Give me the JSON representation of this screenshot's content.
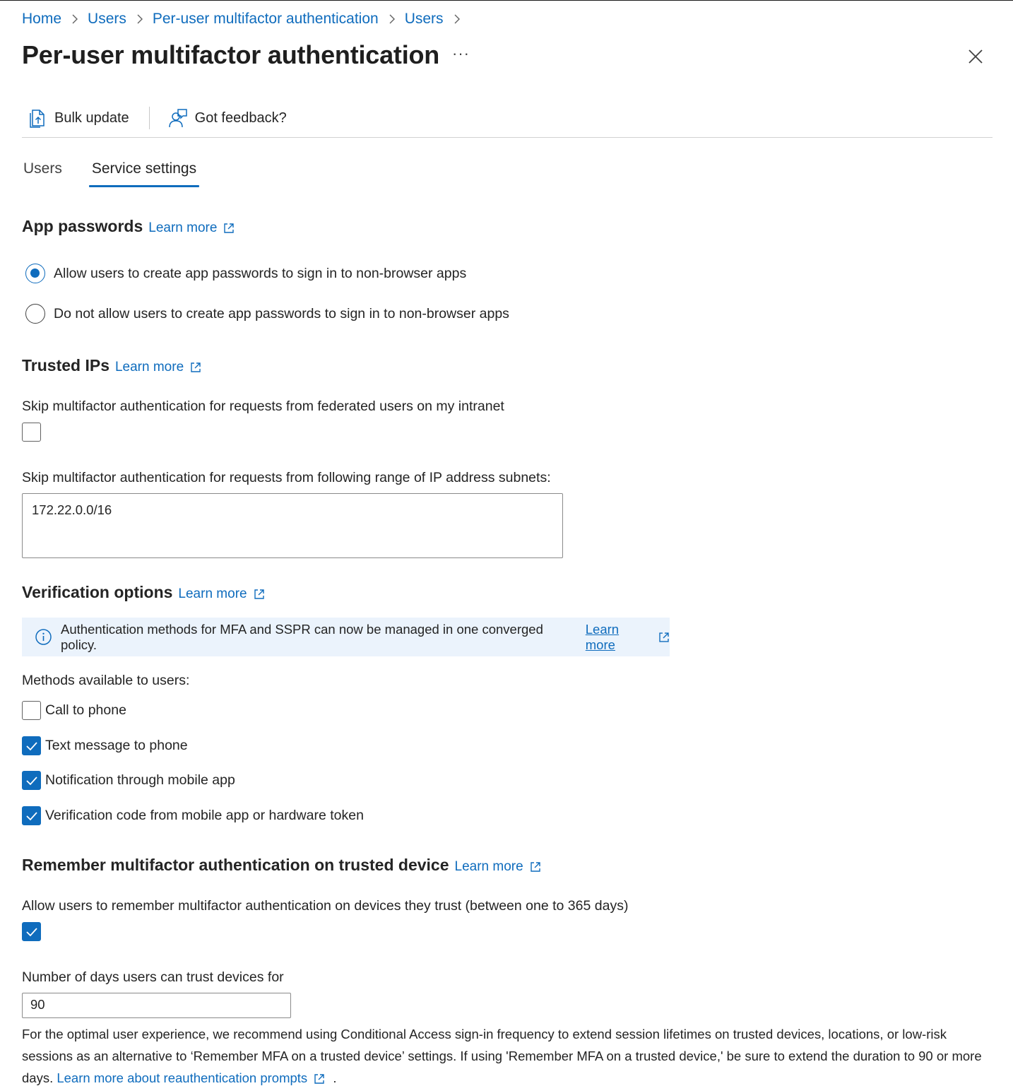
{
  "breadcrumb": [
    "Home",
    "Users",
    "Per-user multifactor authentication",
    "Users"
  ],
  "header": {
    "title": "Per-user multifactor authentication",
    "more": "···"
  },
  "toolbar": {
    "bulk_update": "Bulk update",
    "feedback": "Got feedback?"
  },
  "tabs": [
    {
      "label": "Users",
      "active": false
    },
    {
      "label": "Service settings",
      "active": true
    }
  ],
  "app_passwords": {
    "heading": "App passwords",
    "learn_more": "Learn more",
    "options": [
      {
        "label": "Allow users to create app passwords to sign in to non-browser apps",
        "selected": true
      },
      {
        "label": "Do not allow users to create app passwords to sign in to non-browser apps",
        "selected": false
      }
    ]
  },
  "trusted_ips": {
    "heading": "Trusted IPs",
    "learn_more": "Learn more",
    "skip_federated_label": "Skip multifactor authentication for requests from federated users on my intranet",
    "skip_federated_checked": false,
    "subnets_label": "Skip multifactor authentication for requests from following range of IP address subnets:",
    "subnets_value": "172.22.0.0/16"
  },
  "verification": {
    "heading": "Verification options",
    "learn_more": "Learn more",
    "info_text": "Authentication methods for MFA and SSPR can now be managed in one converged policy.",
    "info_link": "Learn more",
    "methods_label": "Methods available to users:",
    "methods": [
      {
        "label": "Call to phone",
        "checked": false
      },
      {
        "label": "Text message to phone",
        "checked": true
      },
      {
        "label": "Notification through mobile app",
        "checked": true
      },
      {
        "label": "Verification code from mobile app or hardware token",
        "checked": true
      }
    ]
  },
  "remember": {
    "heading": "Remember multifactor authentication on trusted device",
    "learn_more": "Learn more",
    "allow_label": "Allow users to remember multifactor authentication on devices they trust (between one to 365 days)",
    "allow_checked": true,
    "days_label": "Number of days users can trust devices for",
    "days_value": "90",
    "note_text": "For the optimal user experience, we recommend using Conditional Access sign-in frequency to extend session lifetimes on trusted devices, locations, or low-risk sessions as an alternative to ‘Remember MFA on a trusted device’ settings. If using 'Remember MFA on a trusted device,' be sure to extend the duration to 90 or more days.",
    "note_link": "Learn more about reauthentication prompts",
    "note_end": "."
  },
  "colors": {
    "accent": "#0f6cbd",
    "info_bg": "#ebf3fc",
    "text": "#242424"
  }
}
